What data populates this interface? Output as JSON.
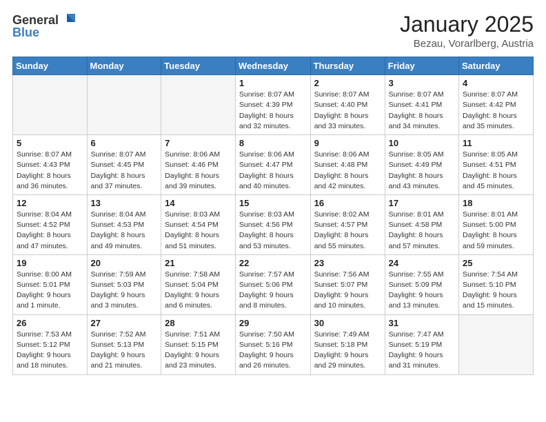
{
  "logo": {
    "general": "General",
    "blue": "Blue"
  },
  "header": {
    "title": "January 2025",
    "subtitle": "Bezau, Vorarlberg, Austria"
  },
  "weekdays": [
    "Sunday",
    "Monday",
    "Tuesday",
    "Wednesday",
    "Thursday",
    "Friday",
    "Saturday"
  ],
  "weeks": [
    [
      {
        "day": "",
        "info": ""
      },
      {
        "day": "",
        "info": ""
      },
      {
        "day": "",
        "info": ""
      },
      {
        "day": "1",
        "info": "Sunrise: 8:07 AM\nSunset: 4:39 PM\nDaylight: 8 hours\nand 32 minutes."
      },
      {
        "day": "2",
        "info": "Sunrise: 8:07 AM\nSunset: 4:40 PM\nDaylight: 8 hours\nand 33 minutes."
      },
      {
        "day": "3",
        "info": "Sunrise: 8:07 AM\nSunset: 4:41 PM\nDaylight: 8 hours\nand 34 minutes."
      },
      {
        "day": "4",
        "info": "Sunrise: 8:07 AM\nSunset: 4:42 PM\nDaylight: 8 hours\nand 35 minutes."
      }
    ],
    [
      {
        "day": "5",
        "info": "Sunrise: 8:07 AM\nSunset: 4:43 PM\nDaylight: 8 hours\nand 36 minutes."
      },
      {
        "day": "6",
        "info": "Sunrise: 8:07 AM\nSunset: 4:45 PM\nDaylight: 8 hours\nand 37 minutes."
      },
      {
        "day": "7",
        "info": "Sunrise: 8:06 AM\nSunset: 4:46 PM\nDaylight: 8 hours\nand 39 minutes."
      },
      {
        "day": "8",
        "info": "Sunrise: 8:06 AM\nSunset: 4:47 PM\nDaylight: 8 hours\nand 40 minutes."
      },
      {
        "day": "9",
        "info": "Sunrise: 8:06 AM\nSunset: 4:48 PM\nDaylight: 8 hours\nand 42 minutes."
      },
      {
        "day": "10",
        "info": "Sunrise: 8:05 AM\nSunset: 4:49 PM\nDaylight: 8 hours\nand 43 minutes."
      },
      {
        "day": "11",
        "info": "Sunrise: 8:05 AM\nSunset: 4:51 PM\nDaylight: 8 hours\nand 45 minutes."
      }
    ],
    [
      {
        "day": "12",
        "info": "Sunrise: 8:04 AM\nSunset: 4:52 PM\nDaylight: 8 hours\nand 47 minutes."
      },
      {
        "day": "13",
        "info": "Sunrise: 8:04 AM\nSunset: 4:53 PM\nDaylight: 8 hours\nand 49 minutes."
      },
      {
        "day": "14",
        "info": "Sunrise: 8:03 AM\nSunset: 4:54 PM\nDaylight: 8 hours\nand 51 minutes."
      },
      {
        "day": "15",
        "info": "Sunrise: 8:03 AM\nSunset: 4:56 PM\nDaylight: 8 hours\nand 53 minutes."
      },
      {
        "day": "16",
        "info": "Sunrise: 8:02 AM\nSunset: 4:57 PM\nDaylight: 8 hours\nand 55 minutes."
      },
      {
        "day": "17",
        "info": "Sunrise: 8:01 AM\nSunset: 4:58 PM\nDaylight: 8 hours\nand 57 minutes."
      },
      {
        "day": "18",
        "info": "Sunrise: 8:01 AM\nSunset: 5:00 PM\nDaylight: 8 hours\nand 59 minutes."
      }
    ],
    [
      {
        "day": "19",
        "info": "Sunrise: 8:00 AM\nSunset: 5:01 PM\nDaylight: 9 hours\nand 1 minute."
      },
      {
        "day": "20",
        "info": "Sunrise: 7:59 AM\nSunset: 5:03 PM\nDaylight: 9 hours\nand 3 minutes."
      },
      {
        "day": "21",
        "info": "Sunrise: 7:58 AM\nSunset: 5:04 PM\nDaylight: 9 hours\nand 6 minutes."
      },
      {
        "day": "22",
        "info": "Sunrise: 7:57 AM\nSunset: 5:06 PM\nDaylight: 9 hours\nand 8 minutes."
      },
      {
        "day": "23",
        "info": "Sunrise: 7:56 AM\nSunset: 5:07 PM\nDaylight: 9 hours\nand 10 minutes."
      },
      {
        "day": "24",
        "info": "Sunrise: 7:55 AM\nSunset: 5:09 PM\nDaylight: 9 hours\nand 13 minutes."
      },
      {
        "day": "25",
        "info": "Sunrise: 7:54 AM\nSunset: 5:10 PM\nDaylight: 9 hours\nand 15 minutes."
      }
    ],
    [
      {
        "day": "26",
        "info": "Sunrise: 7:53 AM\nSunset: 5:12 PM\nDaylight: 9 hours\nand 18 minutes."
      },
      {
        "day": "27",
        "info": "Sunrise: 7:52 AM\nSunset: 5:13 PM\nDaylight: 9 hours\nand 21 minutes."
      },
      {
        "day": "28",
        "info": "Sunrise: 7:51 AM\nSunset: 5:15 PM\nDaylight: 9 hours\nand 23 minutes."
      },
      {
        "day": "29",
        "info": "Sunrise: 7:50 AM\nSunset: 5:16 PM\nDaylight: 9 hours\nand 26 minutes."
      },
      {
        "day": "30",
        "info": "Sunrise: 7:49 AM\nSunset: 5:18 PM\nDaylight: 9 hours\nand 29 minutes."
      },
      {
        "day": "31",
        "info": "Sunrise: 7:47 AM\nSunset: 5:19 PM\nDaylight: 9 hours\nand 31 minutes."
      },
      {
        "day": "",
        "info": ""
      }
    ]
  ]
}
